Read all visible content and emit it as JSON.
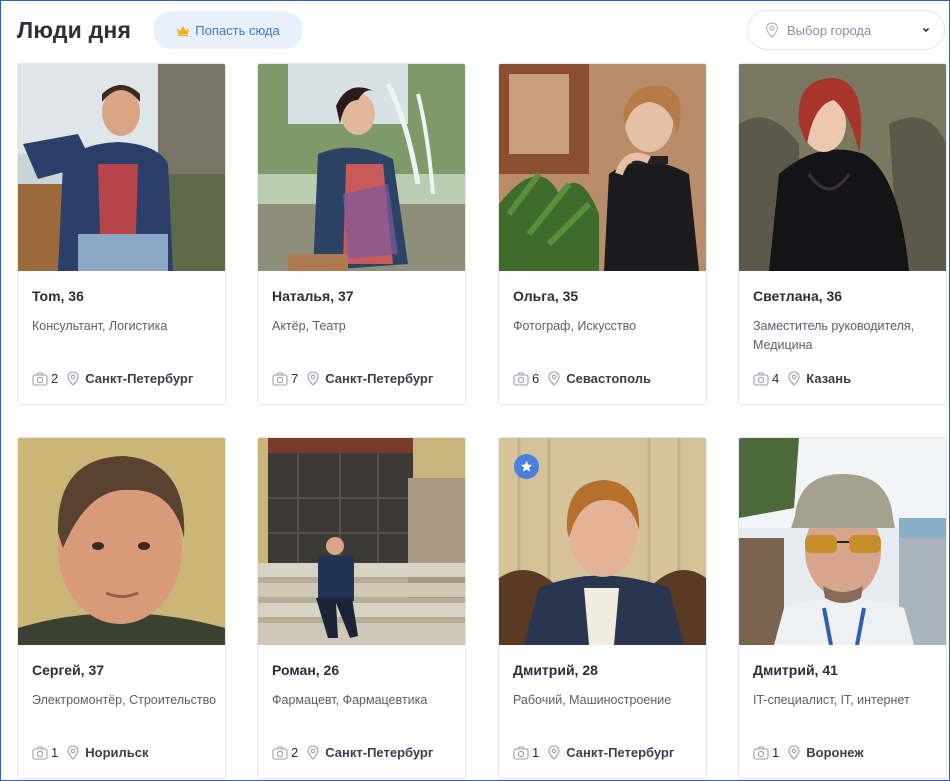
{
  "header": {
    "title": "Люди дня",
    "promo_label": "Попасть сюда",
    "city_placeholder": "Выбор города"
  },
  "colors": {
    "accent": "#3a7bd5",
    "promo_bg": "#e7f0fb",
    "badge": "#4a7fe0"
  },
  "people": [
    {
      "name": "Tom, 36",
      "profession": "Консультант, Логистика",
      "photos": "2",
      "city": "Санкт-Петербург",
      "featured": false
    },
    {
      "name": "Наталья, 37",
      "profession": "Актёр, Театр",
      "photos": "7",
      "city": "Санкт-Петербург",
      "featured": false
    },
    {
      "name": "Ольга, 35",
      "profession": "Фотограф, Искусство",
      "photos": "6",
      "city": "Севастополь",
      "featured": false
    },
    {
      "name": "Светлана, 36",
      "profession": "Заместитель руководителя, Медицина",
      "photos": "4",
      "city": "Казань",
      "featured": false
    },
    {
      "name": "Сергей, 37",
      "profession": "Электромонтёр, Строительство",
      "photos": "1",
      "city": "Норильск",
      "featured": false
    },
    {
      "name": "Роман, 26",
      "profession": "Фармацевт, Фармацевтика",
      "photos": "2",
      "city": "Санкт-Петербург",
      "featured": false
    },
    {
      "name": "Дмитрий, 28",
      "profession": "Рабочий, Машиностроение",
      "photos": "1",
      "city": "Санкт-Петербург",
      "featured": true
    },
    {
      "name": "Дмитрий, 41",
      "profession": "IT-специалист, IT, интернет",
      "photos": "1",
      "city": "Воронеж",
      "featured": false
    }
  ]
}
